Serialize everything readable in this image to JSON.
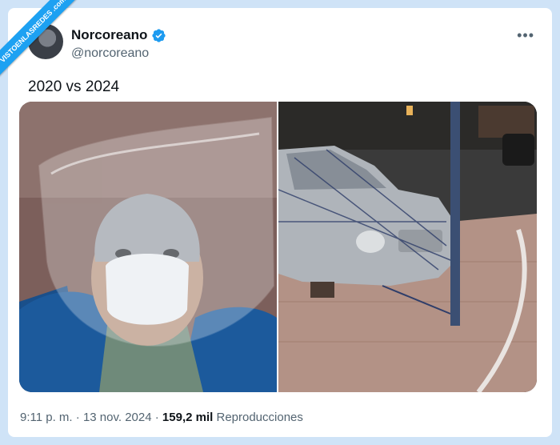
{
  "watermark": {
    "text": "VISTOENLASREDES .com"
  },
  "author": {
    "name": "Norcoreano",
    "handle": "@norcoreano",
    "verified_icon": "verified-badge-icon"
  },
  "tweet": {
    "text": "2020 vs 2024"
  },
  "media": [
    {
      "label": "",
      "description_icon": "person-with-plastic-bag-photo"
    },
    {
      "label": "",
      "description_icon": "car-wrapped-in-plastic-photo"
    }
  ],
  "meta": {
    "time": "9:11 p. m.",
    "sep1": "·",
    "date": "13 nov. 2024",
    "sep2": "·",
    "views_count": "159,2 mil",
    "views_label": "Reproducciones"
  },
  "more_icon": "•••",
  "colors": {
    "background": "#cfe3f7",
    "card": "#ffffff",
    "text": "#0f1419",
    "muted": "#536471",
    "verified": "#1d9bf0"
  }
}
